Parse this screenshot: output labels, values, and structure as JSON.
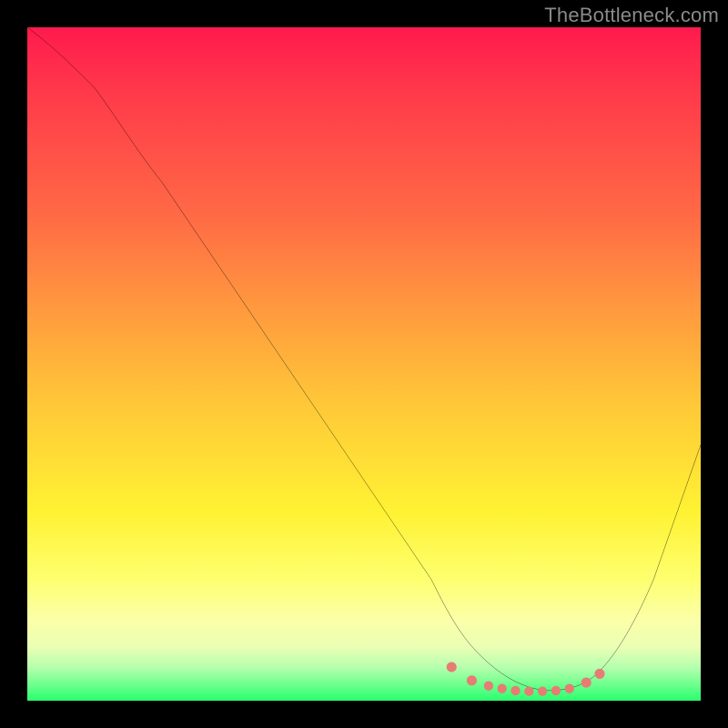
{
  "watermark": "TheBottleneck.com",
  "chart_data": {
    "type": "line",
    "title": "",
    "xlabel": "",
    "ylabel": "",
    "xlim": [
      0,
      100
    ],
    "ylim": [
      0,
      100
    ],
    "gradient_stops": [
      {
        "pct": 0,
        "color": "#ff1a4d"
      },
      {
        "pct": 10,
        "color": "#ff3a4a"
      },
      {
        "pct": 28,
        "color": "#ff6a45"
      },
      {
        "pct": 42,
        "color": "#ff9a3e"
      },
      {
        "pct": 56,
        "color": "#ffc838"
      },
      {
        "pct": 72,
        "color": "#fff233"
      },
      {
        "pct": 82,
        "color": "#fdff6f"
      },
      {
        "pct": 88,
        "color": "#fcffa8"
      },
      {
        "pct": 92,
        "color": "#eaffb4"
      },
      {
        "pct": 95,
        "color": "#b7ffae"
      },
      {
        "pct": 100,
        "color": "#2aff6e"
      }
    ],
    "series": [
      {
        "name": "curve",
        "x": [
          0,
          5,
          10,
          15,
          20,
          25,
          30,
          35,
          40,
          45,
          50,
          55,
          60,
          63,
          67,
          72,
          78,
          82,
          85,
          88,
          92,
          96,
          100
        ],
        "y": [
          100,
          97,
          93,
          86,
          79,
          72,
          64,
          57,
          49,
          42,
          34,
          26,
          18,
          12,
          6,
          2,
          0,
          0,
          1,
          4,
          11,
          22,
          38
        ]
      },
      {
        "name": "trough-markers",
        "x": [
          63,
          67,
          69,
          71,
          73,
          75,
          77,
          79,
          81,
          83,
          85
        ],
        "y": [
          4,
          2,
          2,
          1,
          1,
          1,
          1,
          1,
          2,
          2,
          3
        ]
      }
    ]
  }
}
